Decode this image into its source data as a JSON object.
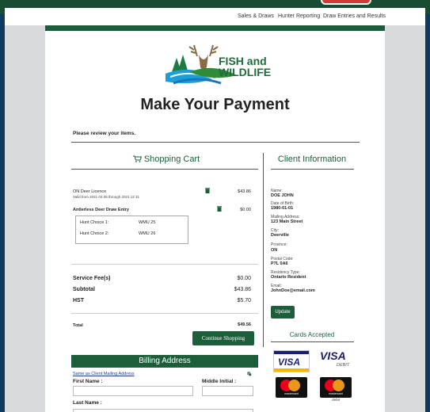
{
  "nav": {
    "links": [
      "Sales & Draws",
      "Hunter Reporting",
      "Draw Entries and Results"
    ]
  },
  "logo": {
    "line1": "FISH and",
    "line2": "WILDLIFE"
  },
  "page_title": "Make Your Payment",
  "review_text": "Please review your items.",
  "cart": {
    "title": "Shopping Cart",
    "items": [
      {
        "name": "ON Deer Licence",
        "sub": "Valid from 2021 03 05 through 2021 12 31",
        "price": "$43.86"
      },
      {
        "name": "Antlerless Deer Draw Entry",
        "sub": "",
        "price": "$0.00"
      }
    ],
    "choices": [
      {
        "label": "Hunt Choice 1:",
        "value": "WMU  25"
      },
      {
        "label": "Hunt Choice 2:",
        "value": "WMU  26"
      }
    ],
    "fees": [
      {
        "label": "Service Fee(s)",
        "value": "$0.00"
      },
      {
        "label": "Subtotal",
        "value": "$43.86"
      },
      {
        "label": "HST",
        "value": "$5.70"
      }
    ],
    "total_label": "Total",
    "total_value": "$49.56",
    "continue_label": "Continue Shopping"
  },
  "client": {
    "title": "Client Information",
    "fields": [
      {
        "label": "Name:",
        "value": "DOE JOHN"
      },
      {
        "label": "Date of Birth:",
        "value": "1980-01-01"
      },
      {
        "label": "Mailing Address:",
        "value": "123 Main Street"
      },
      {
        "label": "City:",
        "value": "Deerville"
      },
      {
        "label": "Province:",
        "value": "ON"
      },
      {
        "label": "Postal Code:",
        "value": "P7L 0A6"
      },
      {
        "label": "Residency Type:",
        "value": "Ontario Resident"
      },
      {
        "label": "Email:",
        "value": "JohnDoe@email.com"
      }
    ],
    "update_label": "Update"
  },
  "cards": {
    "title": "Cards Accepted",
    "visa": "VISA",
    "visa_debit": "VISA",
    "debit": "DEBIT",
    "mastercard": "mastercard",
    "debit_under": "debit"
  },
  "billing": {
    "title": "Billing Address",
    "same_as": "Same as Client Mailing Address",
    "first_name_label": "First Name :",
    "middle_initial_label": "Middle Initial :",
    "last_name_label": "Last Name :"
  },
  "colors": {
    "brand_green": "#1c5d3a",
    "nav_dark_blue": "#0f3b60",
    "link_blue": "#1f3f8a"
  }
}
